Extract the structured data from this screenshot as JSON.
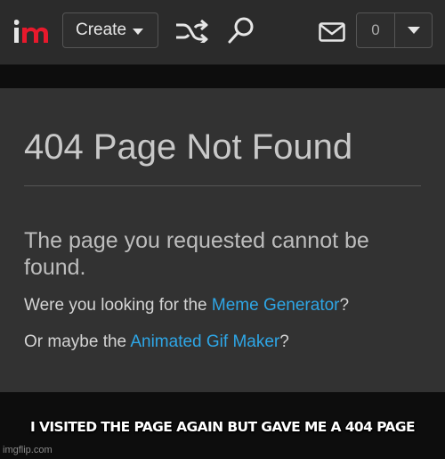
{
  "nav": {
    "logo_icon": "imgflip-logo-icon",
    "create_label": "Create",
    "shuffle_icon": "shuffle-icon",
    "search_icon": "search-icon",
    "mail_icon": "mail-icon",
    "notification_count": "0"
  },
  "page": {
    "title": "404 Page Not Found",
    "message": "The page you requested cannot be found.",
    "line1_prefix": "Were you looking for the ",
    "line1_link": "Meme Generator",
    "line1_suffix": "?",
    "line2_prefix": "Or maybe the ",
    "line2_link": "Animated Gif Maker",
    "line2_suffix": "?"
  },
  "caption": "I VISITED THE PAGE AGAIN BUT GAVE ME A 404 PAGE",
  "watermark": "imgflip.com",
  "colors": {
    "link": "#2ea6e6",
    "logo_red": "#e8192c",
    "nav_bg": "#2b2b2b",
    "panel_bg": "#323232"
  }
}
